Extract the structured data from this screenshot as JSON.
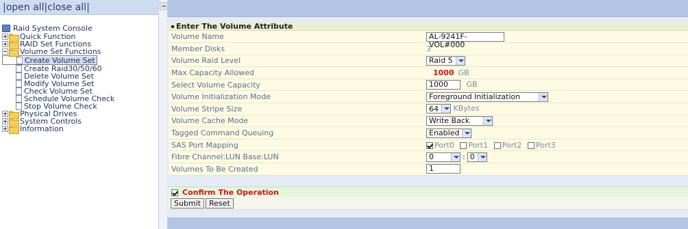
{
  "tree": {
    "open_all": "open all",
    "close_all": "close all",
    "root": "Raid System Console",
    "items": [
      {
        "label": "Quick Function",
        "level": 1,
        "type": "folder",
        "expanded": false
      },
      {
        "label": "RAID Set Functions",
        "level": 1,
        "type": "folder",
        "expanded": false
      },
      {
        "label": "Volume Set Functions",
        "level": 1,
        "type": "folder",
        "expanded": true
      },
      {
        "label": "Create Volume Set",
        "level": 2,
        "type": "page",
        "selected": true
      },
      {
        "label": "Create Raid30/50/60",
        "level": 2,
        "type": "page"
      },
      {
        "label": "Delete Volume Set",
        "level": 2,
        "type": "page"
      },
      {
        "label": "Modify Volume Set",
        "level": 2,
        "type": "page"
      },
      {
        "label": "Check Volume Set",
        "level": 2,
        "type": "page"
      },
      {
        "label": "Schedule Volume Check",
        "level": 2,
        "type": "page"
      },
      {
        "label": "Stop Volume Check",
        "level": 2,
        "type": "page"
      },
      {
        "label": "Physical Drives",
        "level": 1,
        "type": "folder",
        "expanded": false
      },
      {
        "label": "System Controls",
        "level": 1,
        "type": "folder",
        "expanded": false
      },
      {
        "label": "Information",
        "level": 1,
        "type": "folder",
        "expanded": false
      }
    ]
  },
  "form": {
    "title": "Enter The Volume Attribute",
    "volume_name": {
      "label": "Volume Name",
      "value": "AL-9241F-VOL#000"
    },
    "member_disks": {
      "label": "Member Disks",
      "value": "3"
    },
    "raid_level": {
      "label": "Volume Raid Level",
      "value": "Raid 5"
    },
    "max_capacity": {
      "label": "Max Capacity Allowed",
      "value": "1000",
      "unit": "GB"
    },
    "select_capacity": {
      "label": "Select Volume Capacity",
      "value": "1000",
      "unit": "GB"
    },
    "init_mode": {
      "label": "Volume Initialization Mode",
      "value": "Foreground Initialization"
    },
    "stripe_size": {
      "label": "Volume Stripe Size",
      "value": "64",
      "unit": "KBytes"
    },
    "cache_mode": {
      "label": "Volume Cache Mode",
      "value": "Write Back"
    },
    "tcq": {
      "label": "Tagged Command Queuing",
      "value": "Enabled"
    },
    "sas_mapping": {
      "label": "SAS Port Mapping",
      "ports": [
        {
          "name": "Port0",
          "checked": true
        },
        {
          "name": "Port1",
          "checked": false
        },
        {
          "name": "Port2",
          "checked": false
        },
        {
          "name": "Port3",
          "checked": false
        }
      ]
    },
    "fibre_lun": {
      "label": "Fibre Channel:LUN Base:LUN",
      "base": "0",
      "lun": "0",
      "separator": ":"
    },
    "volumes_count": {
      "label": "Volumes To Be Created",
      "value": "1"
    },
    "confirm_label": "Confirm The Operation",
    "confirm_checked": true,
    "submit_label": "Submit",
    "reset_label": "Reset"
  },
  "colors": {
    "accent_red": "#d01515",
    "header_bg": "#b3c6e4",
    "row_bg": "#fdfbe4",
    "confirm_bg": "#e5f6dd"
  }
}
